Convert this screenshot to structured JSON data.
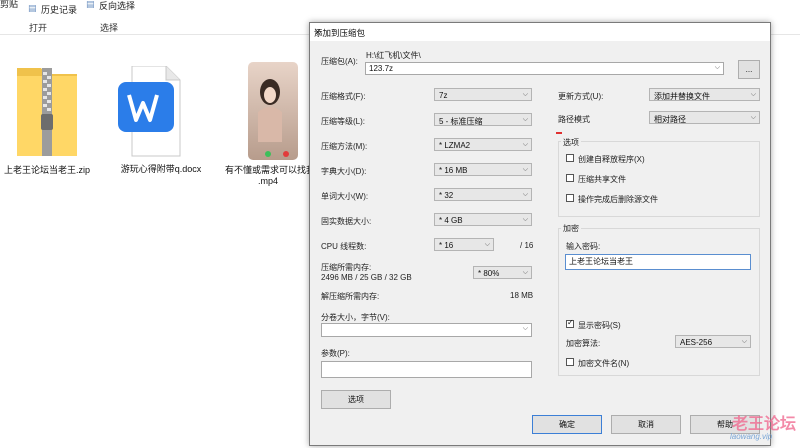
{
  "ribbon": {
    "cut_label": "剪贴",
    "history_label": "历史记录",
    "invert_label": "反向选择",
    "group_open": "打开",
    "group_select": "选择"
  },
  "files": [
    {
      "name": "上老王论坛当老王.zip"
    },
    {
      "name": "游玩心得附带q.docx"
    },
    {
      "name_line1": "有不懂或需求可以找我",
      "name_line2": ".mp4"
    }
  ],
  "dialog": {
    "title": "添加到压缩包",
    "close_glyph": "✕",
    "archive_label": "压缩包(A):",
    "archive_path": "H:\\红飞机\\文件\\",
    "archive_name": "123.7z",
    "browse_label": "...",
    "format_label": "压缩格式(F):",
    "format_value": "7z",
    "level_label": "压缩等级(L):",
    "level_value": "5 - 标准压缩",
    "method_label": "压缩方法(M):",
    "method_value": "* LZMA2",
    "dict_label": "字典大小(D):",
    "dict_value": "* 16 MB",
    "word_label": "单词大小(W):",
    "word_value": "* 32",
    "solid_label": "固实数据大小:",
    "solid_value": "* 4 GB",
    "cpu_label": "CPU 线程数:",
    "cpu_value": "* 16",
    "cpu_total": "/ 16",
    "mem_label": "压缩所需内存:",
    "mem_value": "2496 MB / 25 GB / 32 GB",
    "mem_pct": "* 80%",
    "decomp_label": "解压缩所需内存:",
    "decomp_value": "18 MB",
    "split_label": "分卷大小，字节(V):",
    "split_value": "",
    "params_label": "参数(P):",
    "params_value": "",
    "options_button": "选项",
    "update_label": "更新方式(U):",
    "update_value": "添加并替换文件",
    "path_label": "路径模式",
    "path_value": "相对路径",
    "options_group": "选项",
    "opt_sfx": "创建自释放程序(X)",
    "opt_shared": "压缩共享文件",
    "opt_delete": "操作完成后删除源文件",
    "encrypt_group": "加密",
    "password_label": "输入密码:",
    "password_value": "上老王论坛当老王",
    "show_password": "显示密码(S)",
    "enc_method_label": "加密算法:",
    "enc_method_value": "AES-256",
    "enc_names": "加密文件名(N)",
    "ok": "确定",
    "cancel": "取消",
    "help": "帮助"
  },
  "watermark": {
    "line1": "老王论坛",
    "line2": "laowang.vip"
  }
}
